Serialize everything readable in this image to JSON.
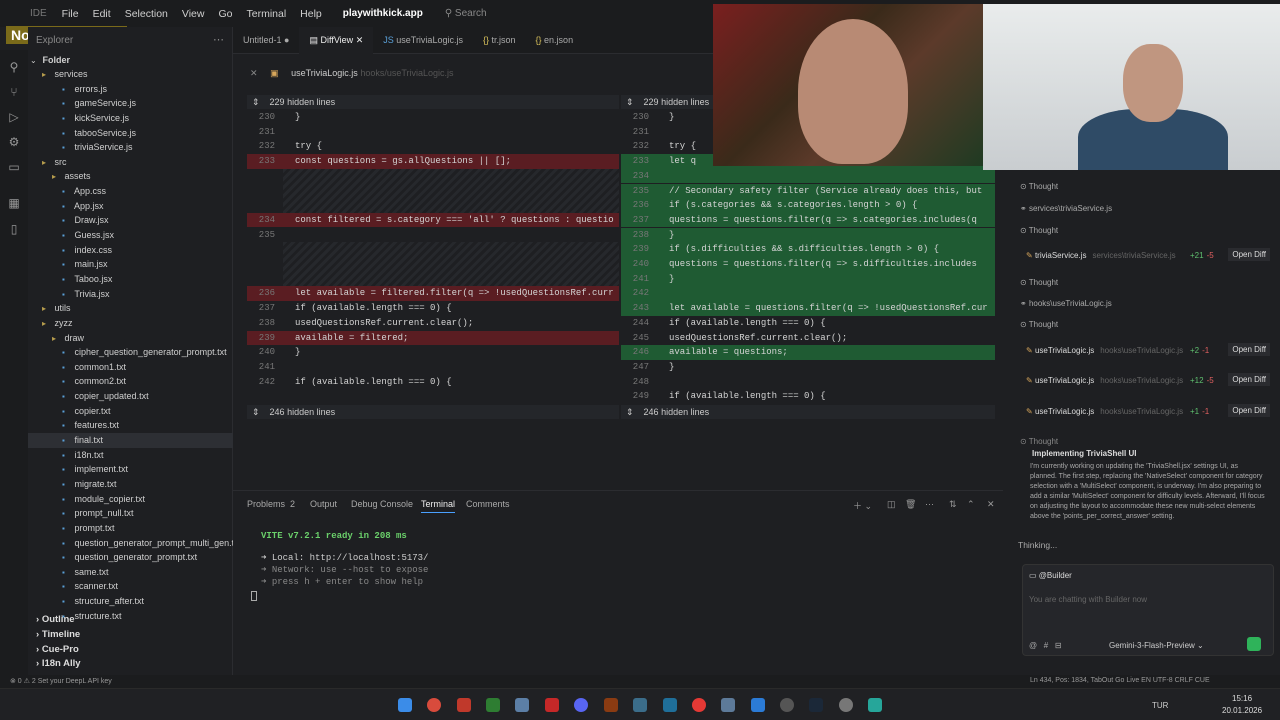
{
  "overlay": {
    "song": "No Song Playing"
  },
  "titlebar": {
    "ide": "IDE",
    "menu": [
      "File",
      "Edit",
      "Selection",
      "View",
      "Go",
      "Terminal",
      "Help"
    ],
    "app": "playwithkick.app",
    "search": "Search"
  },
  "explorer": {
    "header": "Explorer",
    "folder": "Folder",
    "items": [
      {
        "label": "services",
        "kind": "folder",
        "indent": 1
      },
      {
        "label": "errors.js",
        "kind": "file",
        "indent": 3
      },
      {
        "label": "gameService.js",
        "kind": "file",
        "indent": 3
      },
      {
        "label": "kickService.js",
        "kind": "file",
        "indent": 3
      },
      {
        "label": "tabooService.js",
        "kind": "file",
        "indent": 3
      },
      {
        "label": "triviaService.js",
        "kind": "file",
        "indent": 3
      },
      {
        "label": "src",
        "kind": "folder",
        "indent": 1
      },
      {
        "label": "assets",
        "kind": "folder",
        "indent": 2
      },
      {
        "label": "App.css",
        "kind": "file",
        "indent": 3
      },
      {
        "label": "App.jsx",
        "kind": "file",
        "indent": 3
      },
      {
        "label": "Draw.jsx",
        "kind": "file",
        "indent": 3
      },
      {
        "label": "Guess.jsx",
        "kind": "file",
        "indent": 3
      },
      {
        "label": "index.css",
        "kind": "file",
        "indent": 3
      },
      {
        "label": "main.jsx",
        "kind": "file",
        "indent": 3
      },
      {
        "label": "Taboo.jsx",
        "kind": "file",
        "indent": 3
      },
      {
        "label": "Trivia.jsx",
        "kind": "file",
        "indent": 3
      },
      {
        "label": "utils",
        "kind": "folder",
        "indent": 1
      },
      {
        "label": "zyzz",
        "kind": "folder",
        "indent": 1
      },
      {
        "label": "draw",
        "kind": "folder",
        "indent": 2
      },
      {
        "label": "cipher_question_generator_prompt.txt",
        "kind": "file",
        "indent": 3
      },
      {
        "label": "common1.txt",
        "kind": "file",
        "indent": 3
      },
      {
        "label": "common2.txt",
        "kind": "file",
        "indent": 3
      },
      {
        "label": "copier_updated.txt",
        "kind": "file",
        "indent": 3
      },
      {
        "label": "copier.txt",
        "kind": "file",
        "indent": 3
      },
      {
        "label": "features.txt",
        "kind": "file",
        "indent": 3
      },
      {
        "label": "final.txt",
        "kind": "file",
        "indent": 3,
        "selected": true
      },
      {
        "label": "i18n.txt",
        "kind": "file",
        "indent": 3
      },
      {
        "label": "implement.txt",
        "kind": "file",
        "indent": 3
      },
      {
        "label": "migrate.txt",
        "kind": "file",
        "indent": 3
      },
      {
        "label": "module_copier.txt",
        "kind": "file",
        "indent": 3
      },
      {
        "label": "prompt_null.txt",
        "kind": "file",
        "indent": 3
      },
      {
        "label": "prompt.txt",
        "kind": "file",
        "indent": 3
      },
      {
        "label": "question_generator_prompt_multi_gen.txt",
        "kind": "file",
        "indent": 3
      },
      {
        "label": "question_generator_prompt.txt",
        "kind": "file",
        "indent": 3
      },
      {
        "label": "same.txt",
        "kind": "file",
        "indent": 3
      },
      {
        "label": "scanner.txt",
        "kind": "file",
        "indent": 3
      },
      {
        "label": "structure_after.txt",
        "kind": "file",
        "indent": 3
      },
      {
        "label": "structure.txt",
        "kind": "file",
        "indent": 3
      }
    ],
    "sections": [
      "Outline",
      "Timeline",
      "Cue-Pro",
      "I18n Ally"
    ]
  },
  "tabs": [
    "Untitled-1",
    "DiffView",
    "useTriviaLogic.js",
    "tr.json",
    "en.json"
  ],
  "breadcrumb": {
    "file": "useTriviaLogic.js",
    "path": "hooks/useTriviaLogic.js"
  },
  "diff": {
    "hidden_top": "229 hidden lines",
    "hidden_bottom": "246 hidden lines",
    "left": [
      {
        "n": "230",
        "t": "}"
      },
      {
        "n": "231",
        "t": ""
      },
      {
        "n": "232",
        "t": "try {"
      },
      {
        "n": "233",
        "t": "const questions = gs.allQuestions || [];"
      },
      {
        "n": "234",
        "t": "const filtered = s.category === 'all' ? questions : questio"
      },
      {
        "n": "235",
        "t": ""
      },
      {
        "n": "236",
        "t": "let available = filtered.filter(q => !usedQuestionsRef.curr"
      },
      {
        "n": "237",
        "t": "if (available.length === 0) {"
      },
      {
        "n": "238",
        "t": "usedQuestionsRef.current.clear();"
      },
      {
        "n": "239",
        "t": "available = filtered;"
      },
      {
        "n": "240",
        "t": "}"
      },
      {
        "n": "241",
        "t": ""
      },
      {
        "n": "242",
        "t": "if (available.length === 0) {"
      }
    ],
    "right": [
      {
        "n": "230",
        "t": "}"
      },
      {
        "n": "231",
        "t": ""
      },
      {
        "n": "232",
        "t": "try {"
      },
      {
        "n": "233",
        "t": "let q"
      },
      {
        "n": "234",
        "t": ""
      },
      {
        "n": "235",
        "t": "// Secondary safety filter (Service already does this, but"
      },
      {
        "n": "236",
        "t": "if (s.categories && s.categories.length > 0) {"
      },
      {
        "n": "237",
        "t": "questions = questions.filter(q => s.categories.includes(q"
      },
      {
        "n": "238",
        "t": "}"
      },
      {
        "n": "239",
        "t": "if (s.difficulties && s.difficulties.length > 0) {"
      },
      {
        "n": "240",
        "t": "questions = questions.filter(q => s.difficulties.includes"
      },
      {
        "n": "241",
        "t": "}"
      },
      {
        "n": "242",
        "t": ""
      },
      {
        "n": "243",
        "t": "let available = questions.filter(q => !usedQuestionsRef.cur"
      },
      {
        "n": "244",
        "t": "if (available.length === 0) {"
      },
      {
        "n": "245",
        "t": "usedQuestionsRef.current.clear();"
      },
      {
        "n": "246",
        "t": "available = questions;"
      },
      {
        "n": "247",
        "t": "}"
      },
      {
        "n": "248",
        "t": ""
      },
      {
        "n": "249",
        "t": "if (available.length === 0) {"
      }
    ]
  },
  "panel": {
    "tabs": [
      "Problems",
      "Output",
      "Debug Console",
      "Terminal",
      "Comments"
    ],
    "problems_count": "2",
    "terminal": [
      "VITE v7.2.1  ready in 208 ms",
      "➜  Local:   http://localhost:5173/",
      "➜  Network: use --host to expose",
      "➜  press h + enter to show help"
    ]
  },
  "chat": {
    "rows": [
      {
        "type": "thought",
        "text": "Thought"
      },
      {
        "type": "link",
        "text": "services\\triviaService.js"
      },
      {
        "type": "thought",
        "text": "Thought"
      },
      {
        "type": "file",
        "name": "triviaService.js",
        "path": "services\\triviaService.js",
        "add": "+21",
        "del": "-5",
        "btn": "Open Diff"
      },
      {
        "type": "thought",
        "text": "Thought"
      },
      {
        "type": "link",
        "text": "hooks\\useTriviaLogic.js"
      },
      {
        "type": "thought",
        "text": "Thought"
      },
      {
        "type": "file",
        "name": "useTriviaLogic.js",
        "path": "hooks\\useTriviaLogic.js",
        "add": "+2",
        "del": "-1",
        "btn": "Open Diff"
      },
      {
        "type": "file",
        "name": "useTriviaLogic.js",
        "path": "hooks\\useTriviaLogic.js",
        "add": "+12",
        "del": "-5",
        "btn": "Open Diff"
      },
      {
        "type": "file",
        "name": "useTriviaLogic.js",
        "path": "hooks\\useTriviaLogic.js",
        "add": "+1",
        "del": "-1",
        "btn": "Open Diff"
      },
      {
        "type": "thought",
        "text": "Thought"
      }
    ],
    "think_title": "Implementing TriviaShell UI",
    "think_body": "I'm currently working on updating the 'TriviaShell.jsx' settings UI, as planned. The first step, replacing the 'NativeSelect' component for category selection with a 'MultiSelect' component, is underway. I'm also preparing to add a similar 'MultiSelect' component for difficulty levels. Afterward, I'll focus on adjusting the layout to accommodate these new multi-select elements above the 'points_per_correct_answer' setting.",
    "thinking": "Thinking...",
    "builder": "@Builder",
    "placeholder": "You are chatting with Builder now",
    "model": "Gemini-3-Flash-Preview"
  },
  "statusbar": {
    "left": "⊗ 0 ⚠ 2   Set your DeepL API key",
    "right": "Ln 434, Pos: 1834, TabOut   Go Live   EN   UTF-8   CRLF   CUE"
  },
  "taskbar": {
    "lang": "TUR",
    "time": "15:16",
    "date": "20.01.2026"
  }
}
